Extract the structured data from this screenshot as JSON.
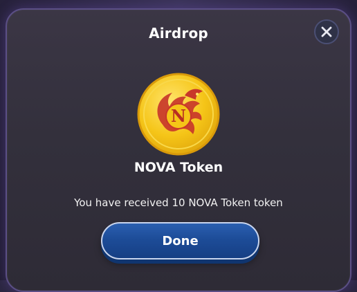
{
  "modal": {
    "title": "Airdrop",
    "token_name": "NOVA Token",
    "message": "You have received 10 NOVA Token token",
    "done_label": "Done",
    "coin_letter": "N"
  },
  "icons": {
    "close": "close-icon",
    "coin": "nova-token-coin-icon"
  },
  "colors": {
    "accent": "#1d4c98",
    "coin_gold": "#f5c518",
    "dragon_red": "#c8372a"
  }
}
